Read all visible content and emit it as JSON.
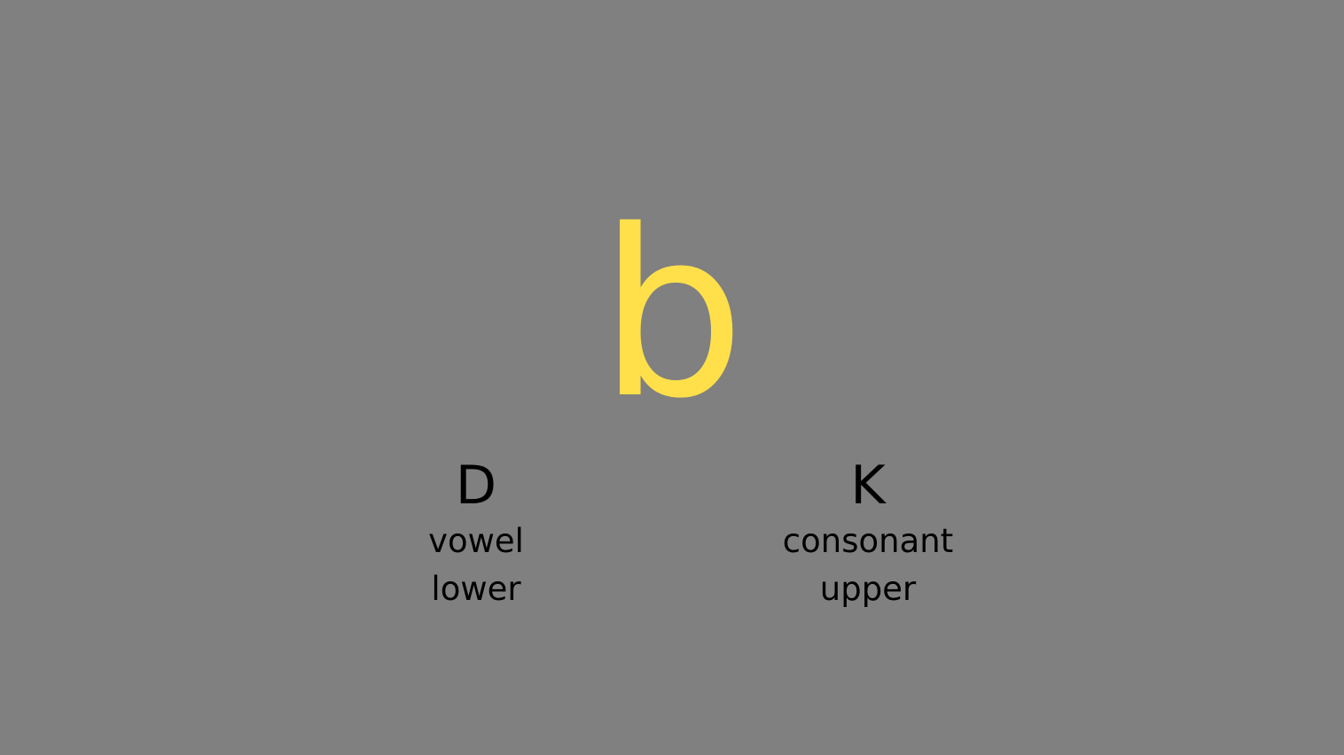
{
  "stimulus": {
    "letter": "b",
    "color": "#FFE04A"
  },
  "options": {
    "left": {
      "key": "D",
      "line1": "vowel",
      "line2": "lower"
    },
    "right": {
      "key": "K",
      "line1": "consonant",
      "line2": "upper"
    }
  },
  "colors": {
    "background": "#808080",
    "text": "#000000"
  }
}
